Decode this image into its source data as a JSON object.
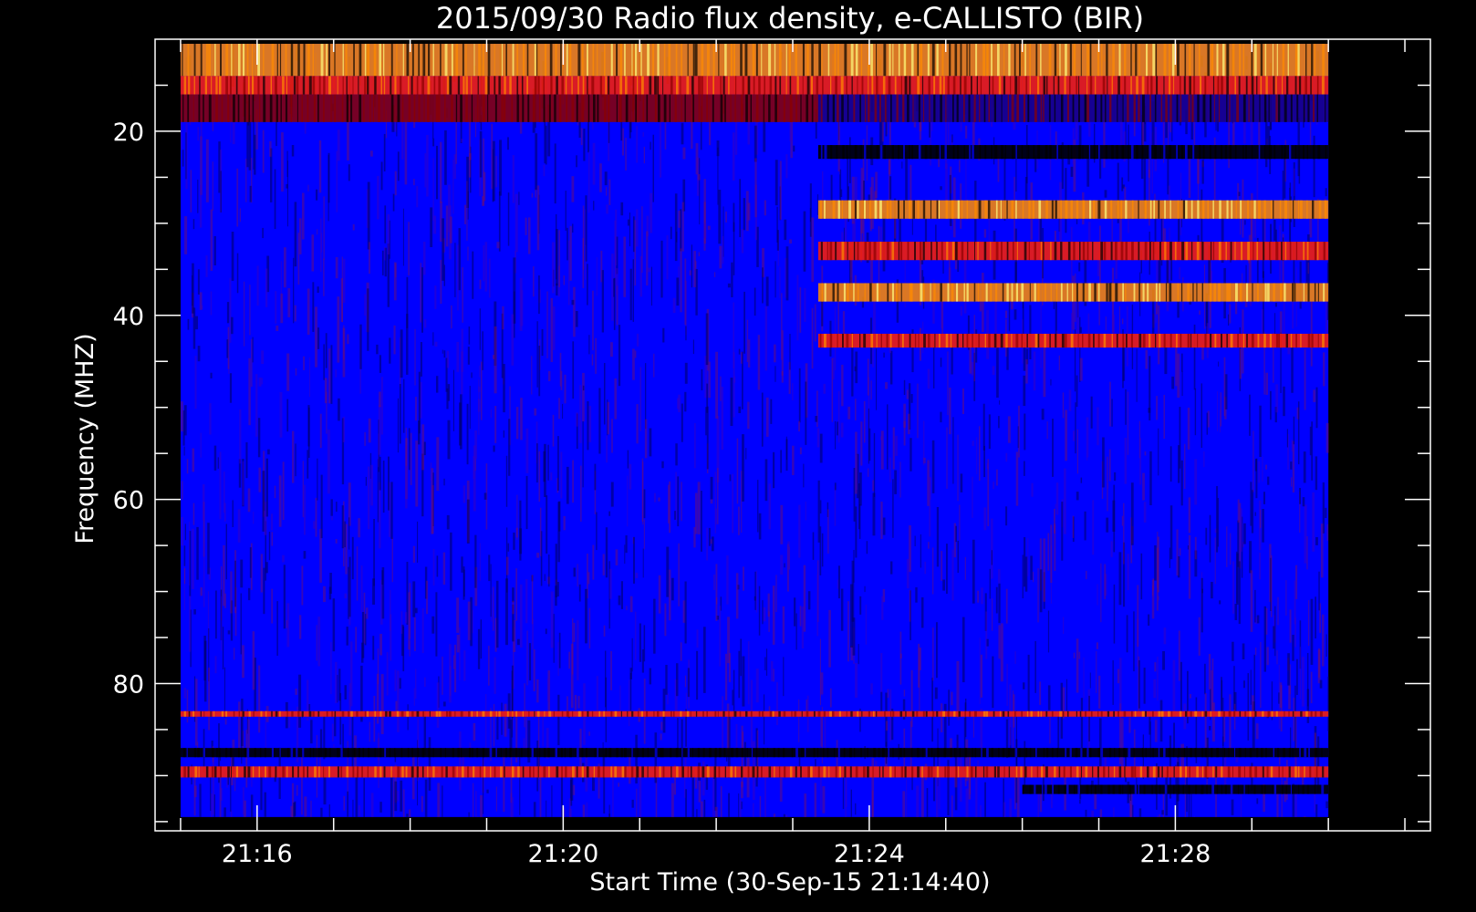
{
  "chart_data": {
    "type": "heatmap",
    "title": "2015/09/30  Radio flux density, e-CALLISTO (BIR)",
    "xlabel": "Start Time (30-Sep-15 21:14:40)",
    "ylabel": "Frequency (MHZ)",
    "x_range": [
      "21:14:40",
      "21:31:20"
    ],
    "x_data_range": [
      "21:15:00",
      "21:30:00"
    ],
    "x_ticks": [
      "21:16",
      "21:20",
      "21:24",
      "21:28"
    ],
    "ylim": [
      96,
      10
    ],
    "y_data_range": [
      94.5,
      10.5
    ],
    "y_ticks": [
      20,
      40,
      60,
      80
    ],
    "y_inverted": true,
    "colormap": [
      "#000000",
      "#0000ff",
      "#8b0000",
      "#ff2000",
      "#ff8c00",
      "#ffff80"
    ],
    "background": "#000000",
    "bands": [
      {
        "y": [
          10.5,
          14
        ],
        "from": "21:15:00",
        "to": "21:30:00",
        "level": "very-high",
        "note": "bright red/yellow striped"
      },
      {
        "y": [
          14,
          16
        ],
        "from": "21:15:00",
        "to": "21:30:00",
        "level": "high",
        "note": "red striped"
      },
      {
        "y": [
          16,
          19
        ],
        "from": "21:15:00",
        "to": "21:23:20",
        "level": "moderate",
        "note": "red/purple"
      },
      {
        "y": [
          16,
          19
        ],
        "from": "21:23:20",
        "to": "21:30:00",
        "level": "low",
        "note": "dark blue/black"
      },
      {
        "y": [
          21.5,
          23
        ],
        "from": "21:23:20",
        "to": "21:30:00",
        "level": "very-low",
        "note": "black"
      },
      {
        "y": [
          27.5,
          29.5
        ],
        "from": "21:23:20",
        "to": "21:30:00",
        "level": "very-high",
        "note": "bright red"
      },
      {
        "y": [
          32,
          34
        ],
        "from": "21:23:20",
        "to": "21:30:00",
        "level": "high",
        "note": "red"
      },
      {
        "y": [
          36.5,
          38.5
        ],
        "from": "21:23:20",
        "to": "21:30:00",
        "level": "very-high",
        "note": "bright red"
      },
      {
        "y": [
          42,
          43.5
        ],
        "from": "21:23:20",
        "to": "21:30:00",
        "level": "high",
        "note": "red"
      },
      {
        "y": [
          83,
          83.6
        ],
        "from": "21:15:00",
        "to": "21:30:00",
        "level": "high",
        "note": "dotted red line"
      },
      {
        "y": [
          87,
          88
        ],
        "from": "21:15:00",
        "to": "21:30:00",
        "level": "very-low",
        "note": "dark line"
      },
      {
        "y": [
          89,
          90.2
        ],
        "from": "21:15:00",
        "to": "21:30:00",
        "level": "high",
        "note": "red line"
      },
      {
        "y": [
          91,
          92
        ],
        "from": "21:26:00",
        "to": "21:30:00",
        "level": "very-low",
        "note": "black line"
      }
    ]
  }
}
